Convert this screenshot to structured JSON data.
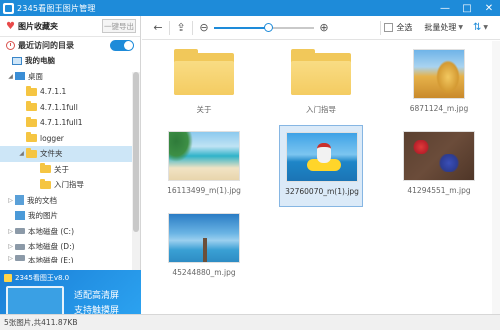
{
  "window": {
    "title": "2345看图王图片管理",
    "buttons": {
      "minimize": "—",
      "maximize": "□",
      "close": "✕"
    }
  },
  "sidebar": {
    "favorites_label": "图片收藏夹",
    "import_label": "一键导出",
    "recent_label": "最近访问的目录",
    "recent_toggle_on": true,
    "tree": [
      {
        "label": "我的电脑",
        "level": 0
      },
      {
        "label": "桌面",
        "level": 1
      },
      {
        "label": "4.7.1.1",
        "level": 2
      },
      {
        "label": "4.7.1.1full",
        "level": 2
      },
      {
        "label": "4.7.1.1full1",
        "level": 2
      },
      {
        "label": "logger",
        "level": 2
      },
      {
        "label": "文件夹",
        "level": 2
      },
      {
        "label": "关于",
        "level": 3
      },
      {
        "label": "入门指导",
        "level": 3
      },
      {
        "label": "我的文档",
        "level": 1
      },
      {
        "label": "我的图片",
        "level": 1
      },
      {
        "label": "本地磁盘 (C:)",
        "level": 1
      },
      {
        "label": "本地磁盘 (D:)",
        "level": 1
      },
      {
        "label": "本地磁盘 (E:)",
        "level": 1
      }
    ],
    "ad": {
      "brand": "2345看图王v8.0",
      "line1": "适配高清屏",
      "line2": "支持触摸屏"
    }
  },
  "toolbar": {
    "zoom_level": 0.55,
    "select_all": "全选",
    "batch": "批量处理"
  },
  "content": {
    "items": [
      {
        "name": "关于",
        "kind": "folder",
        "selected": false
      },
      {
        "name": "入门指导",
        "kind": "folder",
        "selected": false
      },
      {
        "name": "6871124_m.jpg",
        "kind": "photo",
        "thumb": "wheat",
        "selected": false
      },
      {
        "name": "16113499_m(1).jpg",
        "kind": "photo",
        "thumb": "beach",
        "selected": false
      },
      {
        "name": "32760070_m(1).jpg",
        "kind": "photo",
        "thumb": "dog",
        "selected": true
      },
      {
        "name": "41294551_m.jpg",
        "kind": "photo",
        "thumb": "berry",
        "selected": false
      },
      {
        "name": "45244880_m.jpg",
        "kind": "photo",
        "thumb": "pier",
        "selected": false
      }
    ]
  },
  "status": {
    "text": "5张图片,共411.87KB"
  }
}
